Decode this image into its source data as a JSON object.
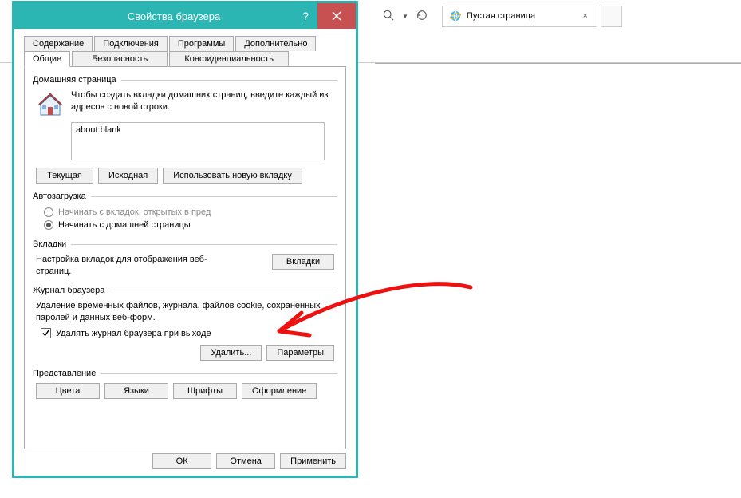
{
  "browser": {
    "tab_title": "Пустая страница"
  },
  "dialog": {
    "title": "Свойства браузера",
    "tabs_row1": [
      "Содержание",
      "Подключения",
      "Программы",
      "Дополнительно"
    ],
    "tabs_row2": [
      "Общие",
      "Безопасность",
      "Конфиденциальность"
    ],
    "active_tab": "Общие"
  },
  "homepage": {
    "group_label": "Домашняя страница",
    "desc": "Чтобы создать вкладки домашних страниц, введите каждый из адресов с новой строки.",
    "value": "about:blank",
    "btn_current": "Текущая",
    "btn_default": "Исходная",
    "btn_newtab": "Использовать новую вкладку"
  },
  "startup": {
    "group_label": "Автозагрузка",
    "opt_tabs": "Начинать с вкладок, открытых в пред",
    "opt_home": "Начинать с домашней страницы"
  },
  "tabs_section": {
    "group_label": "Вкладки",
    "desc": "Настройка вкладок для отображения веб-страниц.",
    "btn": "Вкладки"
  },
  "history": {
    "group_label": "Журнал браузера",
    "desc": "Удаление временных файлов, журнала, файлов cookie, сохраненных паролей и данных веб-форм.",
    "chk_label": "Удалять журнал браузера при выходе",
    "chk_checked": true,
    "btn_delete": "Удалить...",
    "btn_settings": "Параметры"
  },
  "appearance": {
    "group_label": "Представление",
    "btn_colors": "Цвета",
    "btn_lang": "Языки",
    "btn_fonts": "Шрифты",
    "btn_access": "Оформление"
  },
  "footer": {
    "ok": "ОК",
    "cancel": "Отмена",
    "apply": "Применить"
  }
}
